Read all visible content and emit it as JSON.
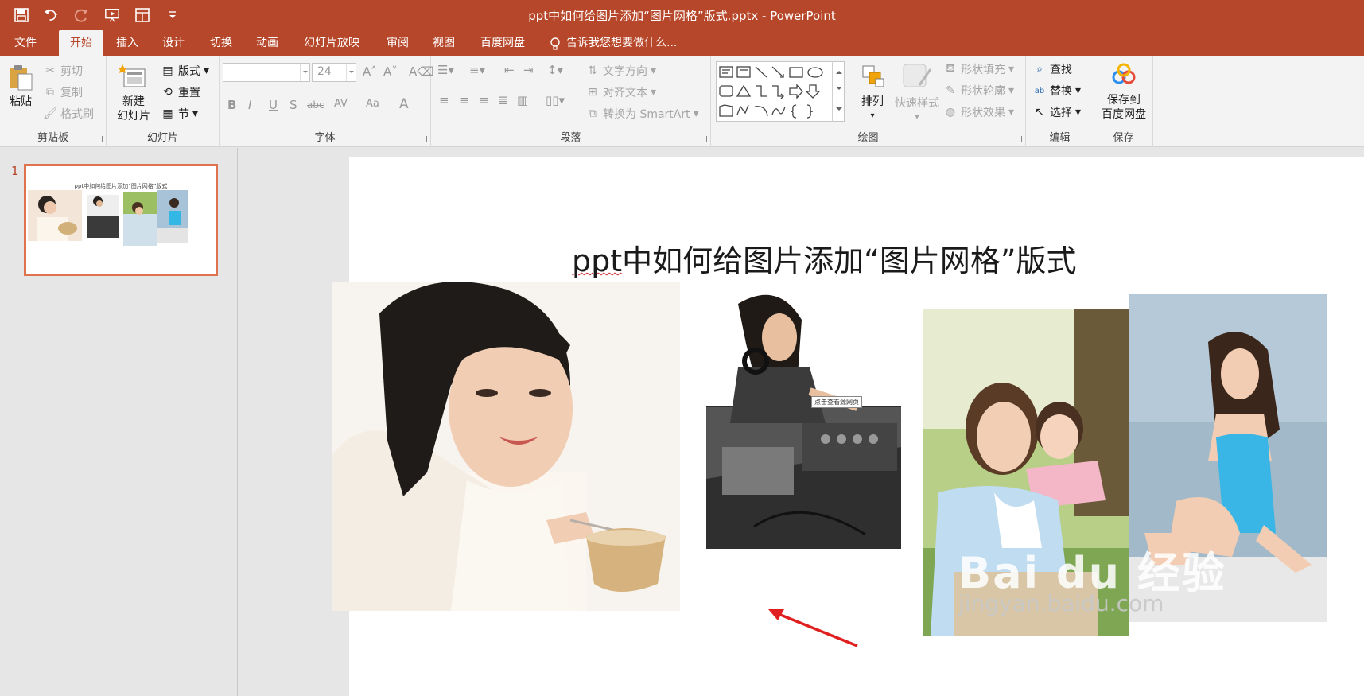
{
  "window": {
    "title": "ppt中如何给图片添加“图片网格”版式.pptx - PowerPoint"
  },
  "qat": {
    "icons": [
      "save-icon",
      "undo-icon",
      "redo-icon",
      "present-from-start-icon",
      "touch-mode-icon",
      "customize-qat-icon"
    ]
  },
  "tabs": [
    "文件",
    "开始",
    "插入",
    "设计",
    "切换",
    "动画",
    "幻灯片放映",
    "审阅",
    "视图",
    "百度网盘"
  ],
  "active_tab": "开始",
  "tell_me": "告诉我您想要做什么...",
  "ribbon": {
    "clipboard": {
      "label": "剪贴板",
      "paste": "粘贴",
      "cut": "剪切",
      "copy": "复制",
      "format_painter": "格式刷"
    },
    "slides": {
      "label": "幻灯片",
      "new_slide_line1": "新建",
      "new_slide_line2": "幻灯片",
      "layout": "版式",
      "reset": "重置",
      "section": "节"
    },
    "font": {
      "label": "字体",
      "font_name": "",
      "font_size": "24",
      "bold": "B",
      "italic": "I",
      "underline": "U",
      "shadow": "S",
      "strike": "abc",
      "spacing": "AV",
      "case": "Aa",
      "font_color": "A"
    },
    "paragraph": {
      "label": "段落",
      "text_direction": "文字方向",
      "align_text": "对齐文本",
      "smartart": "转换为 SmartArt"
    },
    "drawing": {
      "label": "绘图",
      "arrange": "排列",
      "quick_styles": "快速样式",
      "shape_fill": "形状填充",
      "shape_outline": "形状轮廓",
      "shape_effects": "形状效果"
    },
    "editing": {
      "label": "编辑",
      "find": "查找",
      "replace": "替换",
      "select": "选择"
    },
    "save": {
      "label": "保存",
      "save_to_line1": "保存到",
      "save_to_line2": "百度网盘"
    }
  },
  "slides_panel": {
    "slide_number": "1",
    "thumb_title": "ppt中如何给图片添加“图片网格”版式"
  },
  "slide": {
    "title_prefix": "ppt",
    "title_rest": "中如何给图片添加“图片网格”版式",
    "tooltip": "点击查看源网页",
    "watermark_logo": "Bai du 经验",
    "watermark_url": "jingyan.baidu.com"
  },
  "colors": {
    "accent": "#b7472a",
    "thumb_border": "#e0734f",
    "arrow": "#e02020"
  }
}
